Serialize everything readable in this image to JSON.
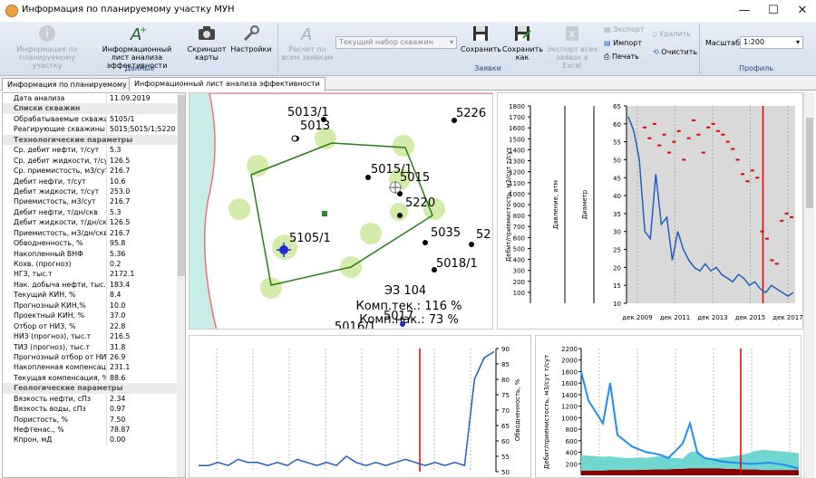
{
  "window": {
    "title": "Информация по планируемому участку МУН",
    "minimize": "—",
    "maximize": "☐",
    "close": "✕"
  },
  "ribbon": {
    "btn_info": "Информация по планируемому участку",
    "btn_sheet": "Информационный лист анализа эффективности",
    "btn_screenshot": "Скриншот карты",
    "btn_settings": "Настройки",
    "group_data": "Данные",
    "btn_calc": "Расчет по всем заявкам",
    "wellset_value": "Текущий набор скважин",
    "btn_save": "Сохранить",
    "btn_save_as": "Сохранить как",
    "btn_export_all": "Экспорт всех заявок в Excel",
    "btn_export": "Экспорт",
    "btn_import": "Импорт",
    "btn_print": "Печать",
    "btn_delete": "Удалить",
    "btn_clear": "Очистить",
    "group_requests": "Заявки",
    "scale_label": "Масштаб",
    "scale_value": "1:200",
    "group_profile": "Профиль"
  },
  "tabs": [
    "Информация по планируемому участку",
    "Информационный лист анализа эффективности"
  ],
  "properties": [
    {
      "k": "Дата анализа",
      "v": "11.09.2019"
    },
    {
      "cat": "Списки скважин"
    },
    {
      "k": "Обрабатываемые скважины",
      "v": "5105/1"
    },
    {
      "k": "Реагирующие скважины",
      "v": "5015;5015/1;5220"
    },
    {
      "cat": "Технологические параметры"
    },
    {
      "k": "Ср. дебит нефти, т/сут",
      "v": "5.3"
    },
    {
      "k": "Ср. дебит жидкости, т/сут",
      "v": "126.5"
    },
    {
      "k": "Ср. приемистость, м3/сут",
      "v": "216.7"
    },
    {
      "k": "Дебит нефти, т/сут",
      "v": "10.6"
    },
    {
      "k": "Дебит жидкости, т/сут",
      "v": "253.0"
    },
    {
      "k": "Приемистость, м3/сут",
      "v": "216.7"
    },
    {
      "k": "Дебит нефти, т/дн/скв",
      "v": "5.3"
    },
    {
      "k": "Дебит жидкости, т/дн/скв",
      "v": "126.5"
    },
    {
      "k": "Приемистость, м3/дн/скв",
      "v": "216.7"
    },
    {
      "k": "Обводненность, %",
      "v": "95.8"
    },
    {
      "k": "Накопленный ВНФ",
      "v": "5.36"
    },
    {
      "k": "Кохв. (прогноз)",
      "v": "0.2"
    },
    {
      "k": "НГЗ, тыс.т",
      "v": "2172.1"
    },
    {
      "k": "Нак. добыча нефти, тыс.т",
      "v": "183.4"
    },
    {
      "k": "Текущий КИН, %",
      "v": "8.4"
    },
    {
      "k": "Прогнозный КИН,%",
      "v": "10.0"
    },
    {
      "k": "Проектный КИН, %",
      "v": "37.0"
    },
    {
      "k": "Отбор от НИЗ, %",
      "v": "22.8"
    },
    {
      "k": "НИЗ (прогноз), тыс.т",
      "v": "216.5"
    },
    {
      "k": "ТИЗ (прогноз), тыс.т",
      "v": "31.8"
    },
    {
      "k": "Прогнозный отбор от НИЗ, %",
      "v": "26.9"
    },
    {
      "k": "Накопленная компенсация, %",
      "v": "231.1"
    },
    {
      "k": "Текущая компенсация, %",
      "v": "88.6"
    },
    {
      "cat": "Геологические параметры"
    },
    {
      "k": "Вязкость нефти, сПз",
      "v": "2.34"
    },
    {
      "k": "Вязкость воды, сПз",
      "v": "0.97"
    },
    {
      "k": "Пористость, %",
      "v": "7.50"
    },
    {
      "k": "Нефтенас., %",
      "v": "78.87"
    },
    {
      "k": "Кпрон, мД",
      "v": "0.00"
    }
  ],
  "map": {
    "wells": [
      "5013/1",
      "5013",
      "5226",
      "5015/1",
      "5015",
      "5220",
      "5105/1",
      "5035",
      "5018/1",
      "52",
      "5016/1",
      "5017"
    ],
    "stats": [
      "ЭЗ 104",
      "Комп.тек.: 116 %",
      "Комп.нак.: 73 %"
    ],
    "colors": {
      "sea": "#c8ede8",
      "land": "#ffffff",
      "shore": "#f07070",
      "zone": "#d4ecaa",
      "polygon": "#2d7a1a"
    }
  },
  "chart_data": [
    {
      "type": "line",
      "title": "",
      "axes": [
        {
          "ylabel": "Дебит/приемистость, м3/сут т/сут",
          "ylim": [
            0,
            1800
          ],
          "ticks": [
            100,
            200,
            300,
            400,
            500,
            600,
            700,
            800,
            900,
            1000,
            1100,
            1200,
            1300,
            1400,
            1500,
            1600,
            1700,
            1800
          ]
        },
        {
          "ylabel": "Давление, атм",
          "ylim": [
            0,
            1
          ],
          "ticks": []
        },
        {
          "ylabel": "Диаметр",
          "ylim": [
            0,
            1
          ],
          "ticks": []
        },
        {
          "ylabel": "",
          "ylim": [
            10,
            65
          ],
          "ticks": [
            10,
            15,
            20,
            25,
            30,
            35,
            40,
            45,
            50,
            55,
            60,
            65
          ]
        }
      ],
      "x_ticks": [
        "дек 2009",
        "дек 2011",
        "дек 2013",
        "дек 2015",
        "дек 2017"
      ],
      "marker_date": "дек 2015",
      "series": [
        {
          "style": "line",
          "color": "#1f5fbf",
          "values": [
            62,
            58,
            50,
            30,
            28,
            46,
            32,
            34,
            22,
            30,
            25,
            22,
            20,
            19,
            21,
            19,
            20,
            18,
            17,
            16,
            18,
            17,
            15,
            16,
            14,
            13,
            15,
            14,
            13,
            12,
            13
          ]
        },
        {
          "style": "dashes",
          "color": "#e00000",
          "values": [
            59,
            56,
            60,
            54,
            57,
            52,
            55,
            58,
            50,
            56,
            61,
            57,
            52,
            59,
            60,
            58,
            57,
            55,
            53,
            50,
            46,
            44,
            47,
            45,
            30,
            28,
            22,
            21,
            33,
            35,
            34
          ]
        }
      ]
    },
    {
      "type": "line",
      "axes": [
        {
          "ylabel": "Обводненность, %",
          "ylim": [
            50,
            90
          ],
          "ticks": [
            50,
            55,
            60,
            65,
            70,
            75,
            80,
            85,
            90
          ]
        }
      ],
      "series": [
        {
          "style": "line",
          "color": "#1f5fbf",
          "values": [
            52,
            52,
            53,
            52,
            54,
            53,
            53,
            52,
            53,
            52,
            54,
            53,
            52,
            53,
            52,
            55,
            53,
            52,
            53,
            52,
            53,
            54,
            53,
            52,
            53,
            52,
            53,
            52,
            80,
            87,
            89
          ]
        }
      ]
    },
    {
      "type": "area",
      "axes": [
        {
          "ylabel": "Дебит/приемистость, м3/сут т/сут",
          "ylim": [
            0,
            2200
          ],
          "ticks": [
            200,
            400,
            600,
            800,
            1000,
            1200,
            1400,
            1600,
            1800,
            2000,
            2200
          ]
        }
      ],
      "series": [
        {
          "style": "line",
          "color": "#1f8fef",
          "values": [
            1800,
            1300,
            1100,
            900,
            1600,
            700,
            600,
            500,
            450,
            400,
            380,
            350,
            300,
            420,
            550,
            900,
            400,
            300,
            280,
            250,
            230,
            220,
            210,
            200,
            200,
            210,
            220,
            200,
            180,
            150,
            120
          ]
        },
        {
          "style": "area",
          "color": "#70d6d0",
          "values": [
            350,
            340,
            330,
            320,
            330,
            310,
            300,
            300,
            310,
            300,
            320,
            330,
            310,
            300,
            290,
            400,
            420,
            300,
            290,
            300,
            310,
            330,
            350,
            380,
            420,
            440,
            430,
            420,
            410,
            400,
            380
          ]
        },
        {
          "style": "area",
          "color": "#8b0000",
          "values": [
            80,
            80,
            80,
            80,
            90,
            90,
            90,
            90,
            95,
            95,
            100,
            100,
            100,
            110,
            110,
            120,
            120,
            120,
            120,
            120,
            110,
            110,
            100,
            100,
            100,
            90,
            90,
            90,
            90,
            90,
            90
          ]
        }
      ]
    }
  ]
}
